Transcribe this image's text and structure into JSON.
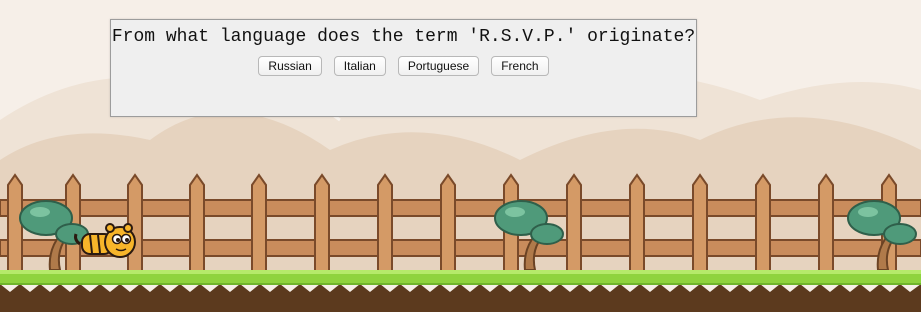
{
  "quiz": {
    "question": "From what language does the term 'R.S.V.P.' originate?",
    "answers": [
      "Russian",
      "Italian",
      "Portuguese",
      "French"
    ]
  },
  "colors": {
    "sky": "#f6efe8",
    "hills": "#e9d8c6",
    "fence": "#c98c5c",
    "grass": "#8fd33e",
    "soil": "#5c3a1e",
    "tree_foliage": "#4f9a7a",
    "player": "#f7b52a"
  },
  "icons": {
    "player": "tiger-character-icon",
    "trees": "bonsai-tree-icon"
  }
}
